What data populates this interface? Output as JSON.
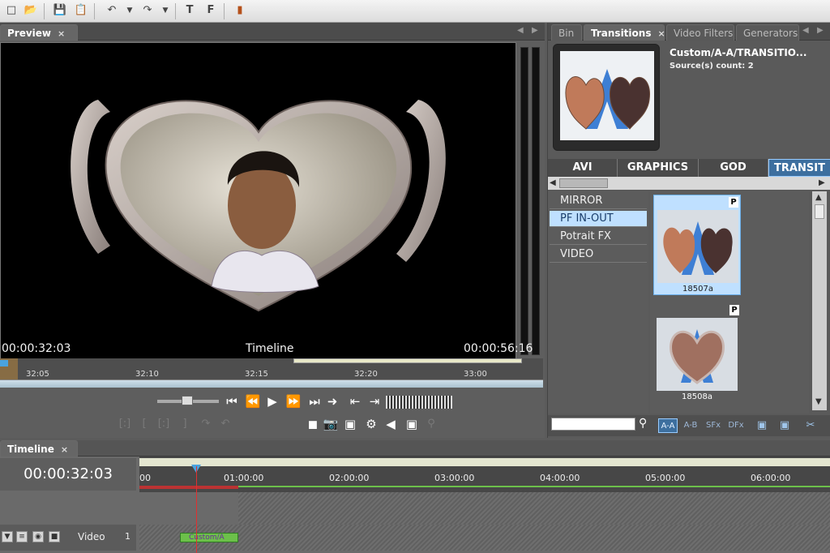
{
  "toolbar": {
    "icons": [
      "new-icon",
      "open-icon",
      "save-icon",
      "save-as-icon",
      "undo-icon",
      "redo-icon",
      "title-icon",
      "effect-icon",
      "chart-icon"
    ]
  },
  "preview": {
    "tab_label": "Preview",
    "tab_close": "×",
    "current_time": "00:00:32:03",
    "timeline_label": "Timeline",
    "end_time": "00:00:56:16",
    "ruler_ticks": [
      "32:05",
      "32:10",
      "32:15",
      "32:20",
      "33:00"
    ],
    "controls": [
      "⏮",
      "⏪",
      "▶",
      "⏩",
      "⏭",
      "⇤",
      "⇥"
    ]
  },
  "right_panel": {
    "tabs": [
      {
        "label": "Bin",
        "active": false
      },
      {
        "label": "Transitions",
        "active": true
      },
      {
        "label": "Video Filters",
        "active": false
      },
      {
        "label": "Generators",
        "active": false
      }
    ],
    "tab_close": "×",
    "selected_name": "Custom/A-A/TRANSITIO...",
    "source_count": "Source(s) count: 2",
    "categories": [
      {
        "label": "AVI",
        "active": false
      },
      {
        "label": "GRAPHICS",
        "active": false
      },
      {
        "label": "GOD",
        "active": false
      },
      {
        "label": "TRANSIT",
        "active": true
      }
    ],
    "list": [
      {
        "label": "MIRROR",
        "active": false
      },
      {
        "label": "PF IN-OUT",
        "active": true
      },
      {
        "label": "Potrait FX",
        "active": false
      },
      {
        "label": "VIDEO",
        "active": false
      }
    ],
    "grid": [
      {
        "caption": "18507a",
        "badge": "P",
        "active": true
      },
      {
        "caption": "18508a",
        "badge": "P",
        "active": false
      }
    ],
    "filters": [
      "A-A",
      "A-B",
      "SFx",
      "DFx"
    ],
    "search_placeholder": ""
  },
  "timeline": {
    "tab_label": "Timeline",
    "tab_close": "×",
    "current_time": "00:00:32:03",
    "ticks": [
      "00",
      "01:00:00",
      "02:00:00",
      "03:00:00",
      "04:00:00",
      "05:00:00",
      "06:00:00"
    ],
    "track_label": "Video",
    "track_number": "1",
    "clip_label": "Custom/A"
  },
  "colors": {
    "accent": "#3d6f9f",
    "selection": "#bfe0ff",
    "playhead": "#e03030",
    "clip": "#6cc04a"
  }
}
